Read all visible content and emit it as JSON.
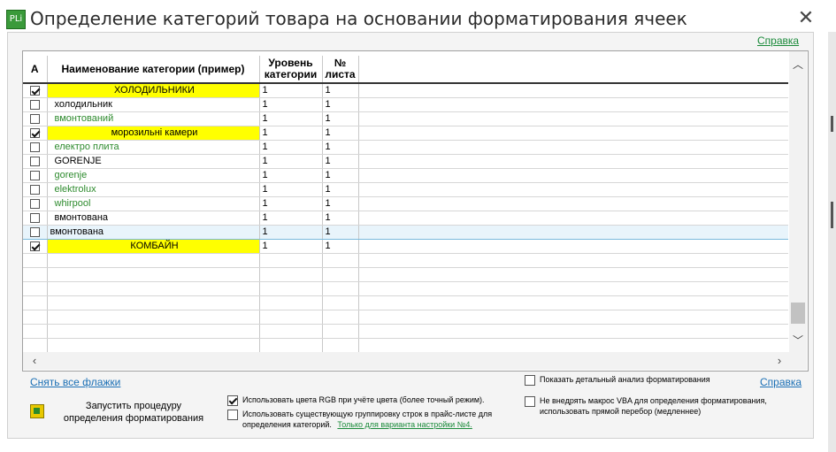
{
  "window": {
    "icon_text": "PLi",
    "title": "Определение категорий товара на основании форматирования ячеек",
    "close_glyph": "✕"
  },
  "help_top": "Справка",
  "grid": {
    "columns": [
      "А",
      "Наименование категории (пример)",
      "Уровень категории",
      "№ листа"
    ],
    "rows": [
      {
        "checked": true,
        "name": "ХОЛОДИЛЬНИКИ",
        "level": "1",
        "sheet": "1",
        "style": "yellow"
      },
      {
        "checked": false,
        "name": "холодильник",
        "level": "1",
        "sheet": "1",
        "style": "plain"
      },
      {
        "checked": false,
        "name": "вмонтований",
        "level": "1",
        "sheet": "1",
        "style": "green"
      },
      {
        "checked": true,
        "name": "морозильні камери",
        "level": "1",
        "sheet": "1",
        "style": "yellow"
      },
      {
        "checked": false,
        "name": "електро плита",
        "level": "1",
        "sheet": "1",
        "style": "green"
      },
      {
        "checked": false,
        "name": "GORENJE",
        "level": "1",
        "sheet": "1",
        "style": "plain"
      },
      {
        "checked": false,
        "name": "gorenje",
        "level": "1",
        "sheet": "1",
        "style": "green"
      },
      {
        "checked": false,
        "name": "elektrolux",
        "level": "1",
        "sheet": "1",
        "style": "green"
      },
      {
        "checked": false,
        "name": "whirpool",
        "level": "1",
        "sheet": "1",
        "style": "green"
      },
      {
        "checked": false,
        "name": "вмонтована",
        "level": "1",
        "sheet": "1",
        "style": "plain"
      },
      {
        "checked": false,
        "name": "вмонтована",
        "level": "1",
        "sheet": "1",
        "style": "selected"
      },
      {
        "checked": true,
        "name": "КОМБАЙН",
        "level": "1",
        "sheet": "1",
        "style": "yellow"
      }
    ],
    "empty_rows": 8
  },
  "clear_flags": "Снять все флажки",
  "run_button": "Запустить процедуру\nопределения форматирования",
  "options": {
    "use_rgb": {
      "checked": true,
      "label": "Использовать цвета RGB при учёте цвета (более точный режим)."
    },
    "use_grouping": {
      "checked": false,
      "label1": "Использовать существующую группировку строк в прайс-листе для",
      "label2": "определения категорий.",
      "link": "Только для варианта настройки №4."
    },
    "detailed_analysis": {
      "checked": false,
      "label": "Показать детальный анализ форматирования"
    },
    "no_vba": {
      "checked": false,
      "label1": "Не внедрять макрос VBA для определения форматирования,",
      "label2": "использовать прямой перебор (медленнее)"
    }
  },
  "help_bottom": "Справка",
  "colors": {
    "highlight": "#ffff00",
    "green_text": "#2e8b2e",
    "link": "#1a6fb5",
    "selected_row": "#e8f4fb"
  },
  "icons": [
    "close-icon",
    "app-icon",
    "scroll-up-icon",
    "scroll-down-icon",
    "scroll-left-icon",
    "scroll-right-icon",
    "run-icon"
  ]
}
